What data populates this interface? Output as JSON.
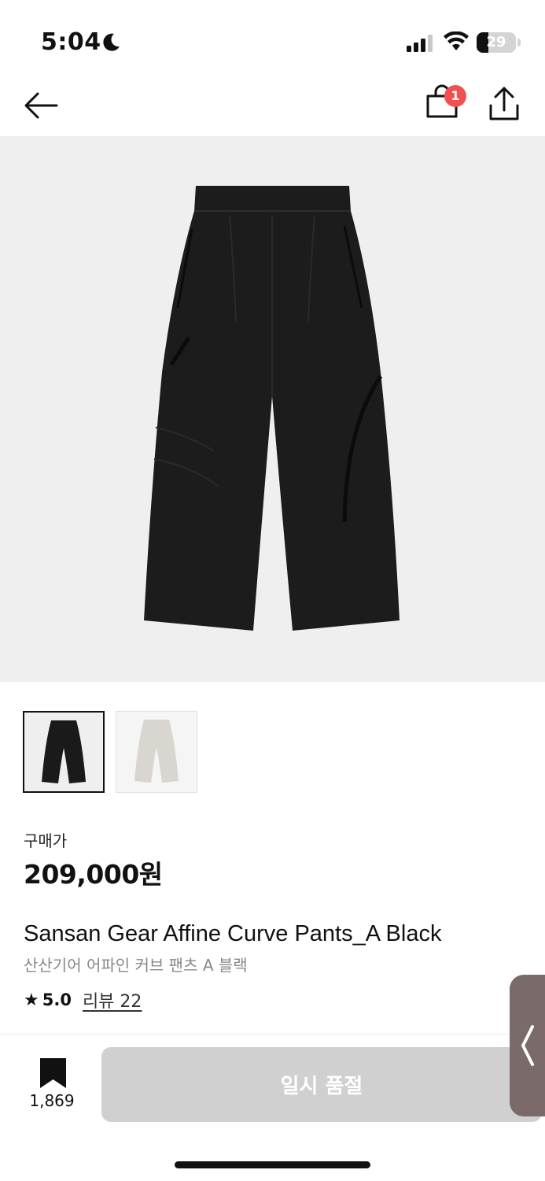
{
  "status_bar": {
    "time": "5:04",
    "battery_level": "29",
    "icons": [
      "moon-icon",
      "signal-icon",
      "wifi-icon",
      "battery-icon"
    ]
  },
  "header": {
    "icons": [
      "arrow-left-icon",
      "shopping-bag-icon",
      "share-icon"
    ],
    "cart_badge": "1"
  },
  "product": {
    "price_label": "구매가",
    "price": "209,000원",
    "name": "Sansan Gear Affine Curve Pants_A Black",
    "name_ko": "산산기어 어파인 커브 팬츠 A 블랙",
    "rating_star": "★",
    "rating": "5.0",
    "reviews": "리뷰 22",
    "thumbnail_colors": [
      "#1a1a1a",
      "#d9d6cf"
    ]
  },
  "bottom_bar": {
    "bookmark_count": "1,869",
    "cta_label": "일시 품절"
  },
  "colors": {
    "badge": "#f2504f",
    "hero_background": "#efefef",
    "soldout_button": "#d0d0d0",
    "side_tab": "#7a6a6a"
  }
}
